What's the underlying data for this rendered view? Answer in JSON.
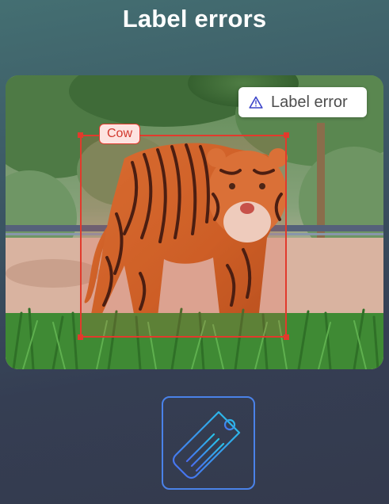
{
  "header": {
    "title": "Label errors"
  },
  "image_card": {
    "subject": "tiger",
    "badge": {
      "icon": "warning-triangle-icon",
      "text": "Label error"
    },
    "annotation": {
      "label": "Cow",
      "color": "#e23a2c"
    }
  },
  "action": {
    "icon": "tag-icon",
    "accent_start": "#4a6cf0",
    "accent_end": "#27c3e8"
  }
}
